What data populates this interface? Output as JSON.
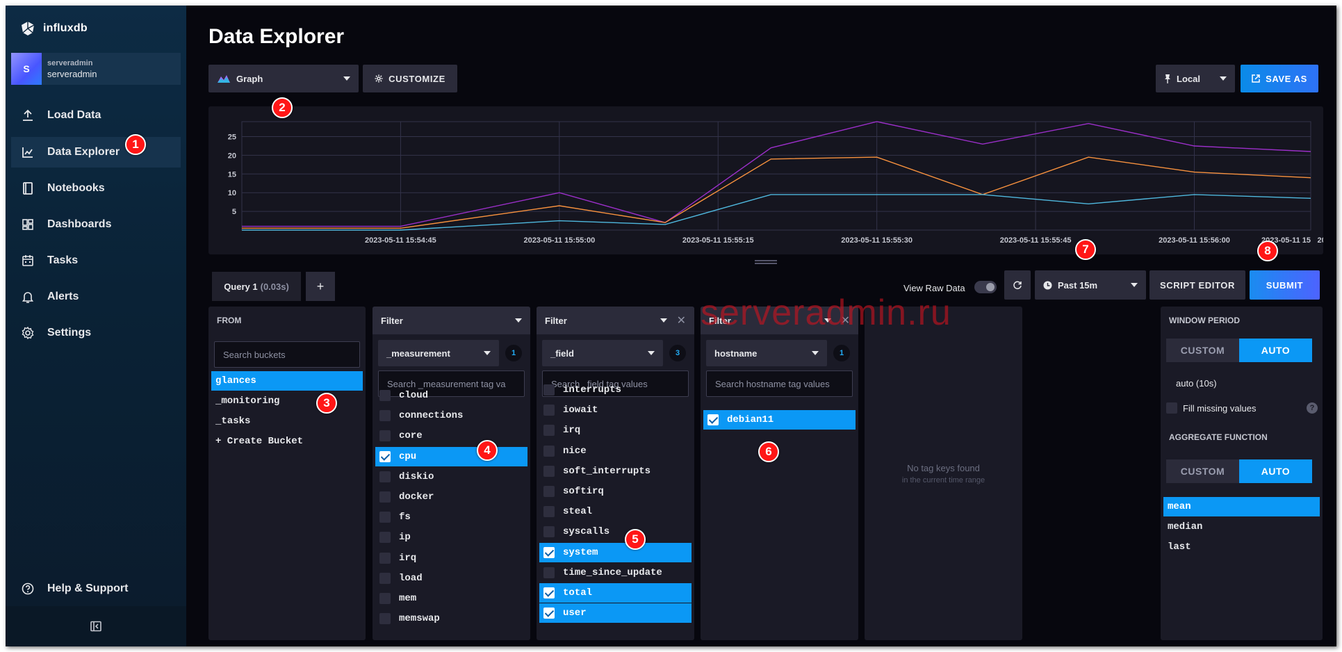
{
  "app": {
    "name": "influxdb"
  },
  "user": {
    "avatar_letter": "S",
    "org": "serveradmin",
    "name": "serveradmin"
  },
  "nav": {
    "items": [
      {
        "label": "Load Data",
        "icon": "upload-icon"
      },
      {
        "label": "Data Explorer",
        "icon": "graph-icon",
        "active": true
      },
      {
        "label": "Notebooks",
        "icon": "notebook-icon"
      },
      {
        "label": "Dashboards",
        "icon": "dashboard-icon"
      },
      {
        "label": "Tasks",
        "icon": "calendar-icon"
      },
      {
        "label": "Alerts",
        "icon": "bell-icon"
      },
      {
        "label": "Settings",
        "icon": "gear-icon"
      }
    ],
    "help": "Help & Support"
  },
  "page": {
    "title": "Data Explorer"
  },
  "toolbar": {
    "view_type": "Graph",
    "customize": "CUSTOMIZE",
    "timezone": "Local",
    "save_as": "SAVE AS"
  },
  "chart_data": {
    "type": "line",
    "x": [
      "2023-05-11 15:54:30",
      "2023-05-11 15:54:45",
      "2023-05-11 15:55:00",
      "2023-05-11 15:55:10",
      "2023-05-11 15:55:20",
      "2023-05-11 15:55:30",
      "2023-05-11 15:55:40",
      "2023-05-11 15:55:50",
      "2023-05-11 15:56:00",
      "2023-05-11 15:56:11"
    ],
    "x_ticks": [
      "2023-05-11 15:54:45",
      "2023-05-11 15:55:00",
      "2023-05-11 15:55:15",
      "2023-05-11 15:55:30",
      "2023-05-11 15:55:45",
      "2023-05-11 15:56:00",
      "2023-05-11 15:56:15",
      "2023-05-11 15"
    ],
    "y_ticks": [
      5,
      10,
      15,
      20,
      25
    ],
    "ylim": [
      0,
      29
    ],
    "series": [
      {
        "color": "#9b2fc9",
        "values": [
          1,
          1,
          10,
          2,
          22,
          29,
          23,
          28.5,
          22.5,
          21
        ]
      },
      {
        "color": "#f7913e",
        "values": [
          0.5,
          0.5,
          6.5,
          2,
          19,
          19.5,
          9.5,
          19.5,
          15.5,
          14
        ]
      },
      {
        "color": "#4fb8de",
        "values": [
          0,
          0,
          2.5,
          1.5,
          9.5,
          9.5,
          9.5,
          7,
          9.5,
          8.5
        ]
      }
    ]
  },
  "query": {
    "tab_name": "Query 1",
    "tab_timing": "(0.03s)",
    "add": "+",
    "view_raw": "View Raw Data",
    "time_range": "Past 15m",
    "script_editor": "SCRIPT EDITOR",
    "submit": "SUBMIT"
  },
  "from": {
    "header": "FROM",
    "search_placeholder": "Search buckets",
    "buckets": [
      {
        "name": "glances",
        "selected": true
      },
      {
        "name": "_monitoring"
      },
      {
        "name": "_tasks"
      },
      {
        "name": "+ Create Bucket"
      }
    ]
  },
  "filters": [
    {
      "header": "Filter",
      "key": "_measurement",
      "count": "1",
      "search_placeholder": "Search _measurement tag va",
      "values": [
        {
          "name": "cloud"
        },
        {
          "name": "connections"
        },
        {
          "name": "core"
        },
        {
          "name": "cpu",
          "selected": true
        },
        {
          "name": "diskio"
        },
        {
          "name": "docker"
        },
        {
          "name": "fs"
        },
        {
          "name": "ip"
        },
        {
          "name": "irq"
        },
        {
          "name": "load"
        },
        {
          "name": "mem"
        },
        {
          "name": "memswap"
        }
      ]
    },
    {
      "header": "Filter",
      "key": "_field",
      "count": "3",
      "search_placeholder": "Search _field tag values",
      "values": [
        {
          "name": "interrupts"
        },
        {
          "name": "iowait"
        },
        {
          "name": "irq"
        },
        {
          "name": "nice"
        },
        {
          "name": "soft_interrupts"
        },
        {
          "name": "softirq"
        },
        {
          "name": "steal"
        },
        {
          "name": "syscalls"
        },
        {
          "name": "system",
          "selected": true
        },
        {
          "name": "time_since_update"
        },
        {
          "name": "total",
          "selected": true
        },
        {
          "name": "user",
          "selected": true
        }
      ]
    },
    {
      "header": "Filter",
      "key": "hostname",
      "count": "1",
      "search_placeholder": "Search hostname tag values",
      "values": [
        {
          "name": "debian11",
          "selected": true
        }
      ]
    }
  ],
  "empty_panel": {
    "title": "No tag keys found",
    "subtitle": "in the current time range"
  },
  "window_period": {
    "header": "WINDOW PERIOD",
    "custom": "CUSTOM",
    "auto": "AUTO",
    "value": "auto (10s)",
    "fill_missing": "Fill missing values",
    "help": "?"
  },
  "aggregate": {
    "header": "AGGREGATE FUNCTION",
    "custom": "CUSTOM",
    "auto": "AUTO",
    "functions": [
      {
        "name": "mean",
        "selected": true
      },
      {
        "name": "median"
      },
      {
        "name": "last"
      }
    ]
  },
  "annotations": [
    "1",
    "2",
    "3",
    "4",
    "5",
    "6",
    "7",
    "8"
  ],
  "watermark": "serveradmin.ru"
}
